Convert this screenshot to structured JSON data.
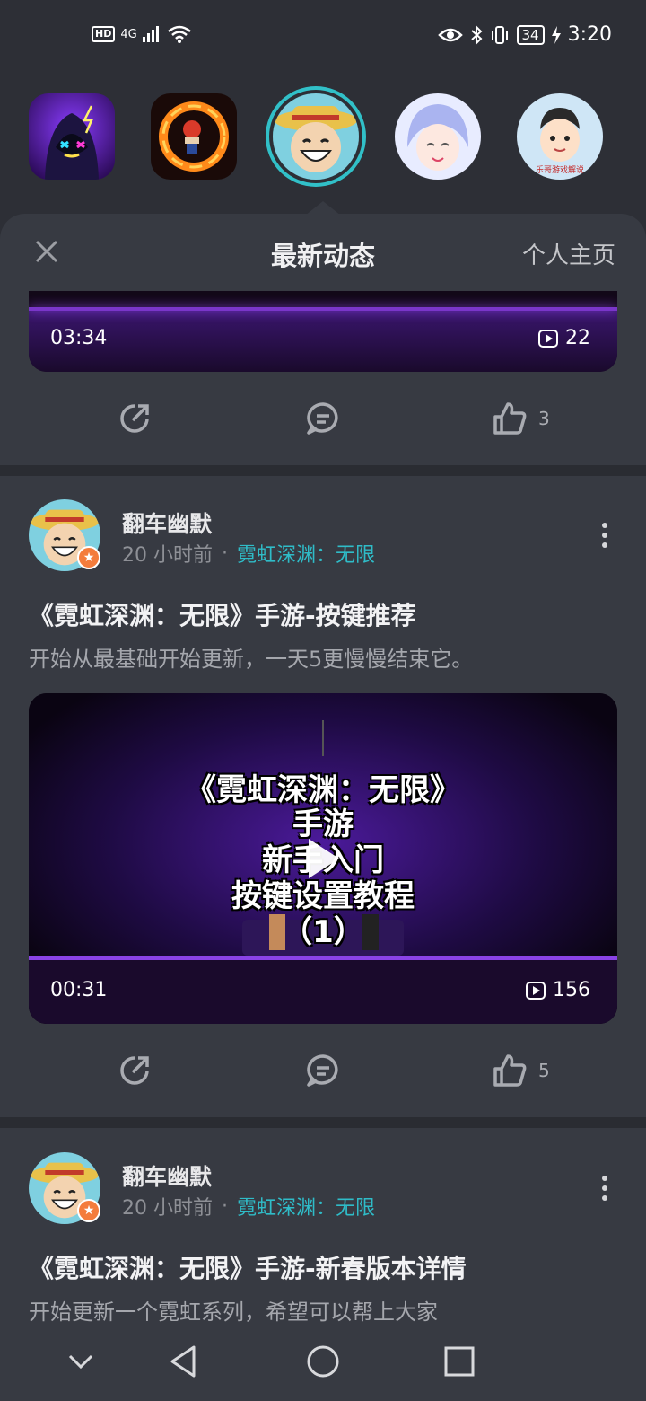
{
  "status_bar": {
    "hd": "HD",
    "network": "4G",
    "battery": "34",
    "time": "3:20"
  },
  "avatars": [
    {
      "name": "avatar-neon-hacker",
      "selected": false
    },
    {
      "name": "avatar-fire-ring",
      "selected": false
    },
    {
      "name": "avatar-straw-hat",
      "selected": true
    },
    {
      "name": "avatar-anime-boy",
      "selected": false
    },
    {
      "name": "avatar-cartoon-man",
      "caption": "乐哥游戏解说"
    }
  ],
  "sheet": {
    "title": "最新动态",
    "profile_link": "个人主页",
    "close_icon": "close-icon"
  },
  "top_card": {
    "duration": "03:34",
    "views": "22",
    "actions": {
      "share_icon": "share-icon",
      "comment_icon": "comment-icon",
      "likes": "3"
    }
  },
  "posts": [
    {
      "author": "翻车幽默",
      "time": "20 小时前",
      "separator": "·",
      "game": "霓虹深渊：无限",
      "title": "《霓虹深渊：无限》手游-按键推荐",
      "body": "开始从最基础开始更新，一天5更慢慢结束它。",
      "video": {
        "duration": "00:31",
        "views": "156",
        "overlay_lines": [
          "《霓虹深渊：无限》",
          "手游",
          "新手入门",
          "按键设置教程",
          "（1）"
        ]
      },
      "likes": "5"
    },
    {
      "author": "翻车幽默",
      "time": "20 小时前",
      "separator": "·",
      "game": "霓虹深渊：无限",
      "title": "《霓虹深渊：无限》手游-新春版本详情",
      "body": "开始更新一个霓虹系列，希望可以帮上大家"
    }
  ],
  "nav_bar": {
    "icons": [
      "chevron-down-icon",
      "back-icon",
      "home-icon",
      "recents-icon"
    ]
  },
  "colors": {
    "accent": "#2fbcc8",
    "background": "#2d2f36",
    "sheet": "#373a42",
    "badge": "#f47c3c"
  }
}
